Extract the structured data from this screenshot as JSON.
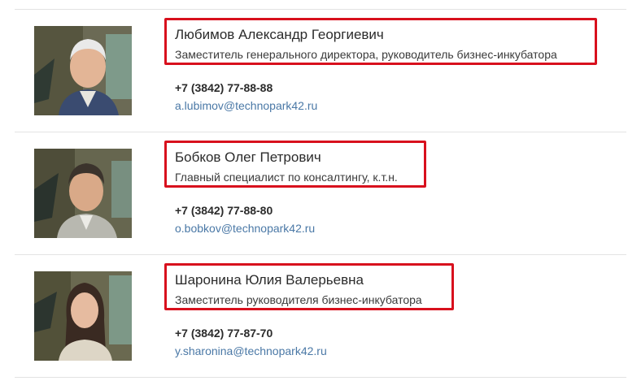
{
  "staff": [
    {
      "name": "Любимов Александр Георгиевич",
      "position": "Заместитель генерального директора, руководитель бизнес-инкубатора",
      "phone": "+7 (3842) 77-88-88",
      "email": "a.lubimov@technopark42.ru"
    },
    {
      "name": "Бобков Олег Петрович",
      "position": "Главный специалист по консалтингу, к.т.н.",
      "phone": "+7 (3842) 77-88-80",
      "email": "o.bobkov@technopark42.ru"
    },
    {
      "name": "Шаронина Юлия Валерьевна",
      "position": "Заместитель руководителя бизнес-инкубатора",
      "phone": "+7 (3842) 77-87-70",
      "email": "y.sharonina@technopark42.ru"
    }
  ],
  "colors": {
    "highlight_border": "#d8101d",
    "link": "#4a78a6",
    "divider": "#e3e3e3"
  }
}
